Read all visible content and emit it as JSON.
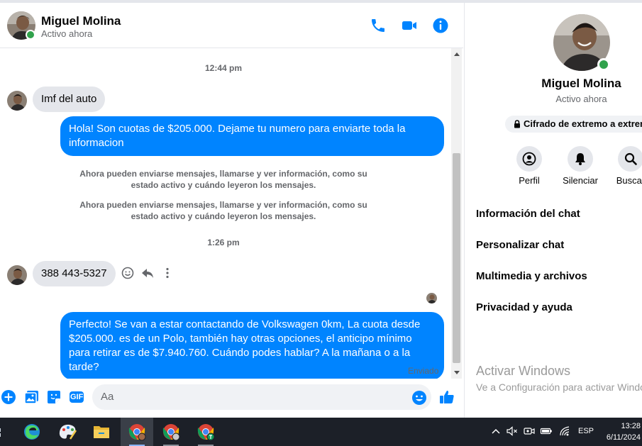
{
  "contact": {
    "name": "Miguel Molina",
    "status": "Activo ahora"
  },
  "header": {
    "icons": [
      "phone-icon",
      "video-camera-icon",
      "info-icon"
    ]
  },
  "messages": {
    "timestamp1": "12:44 pm",
    "incoming1": "Imf del auto",
    "outgoing1": "Hola! Son cuotas de $205.000. Dejame tu numero para enviarte toda la informacion",
    "system1": "Ahora pueden enviarse mensajes, llamarse y ver información, como su estado activo y cuándo leyeron los mensajes.",
    "system2": "Ahora pueden enviarse mensajes, llamarse y ver información, como su estado activo y cuándo leyeron los mensajes.",
    "timestamp2": "1:26 pm",
    "incoming2": "388 443-5327",
    "outgoing2": "Perfecto!  Se van a estar contactando de Volkswagen 0km, La cuota desde $205.000. es de un Polo, también hay otras opciones, el anticipo mínimo para retirar es de $7.940.760. Cuándo podes hablar? A la mañana o a la tarde?",
    "sent_label": "Enviado"
  },
  "composer": {
    "placeholder": "Aa",
    "gif_label": "GIF"
  },
  "info_panel": {
    "name": "Miguel Molina",
    "status": "Activo ahora",
    "encryption": "Cifrado de extremo a extremo",
    "actions": [
      {
        "label": "Perfil",
        "icon": "profile-icon"
      },
      {
        "label": "Silenciar",
        "icon": "bell-icon"
      },
      {
        "label": "Buscar",
        "icon": "search-icon"
      }
    ],
    "menu": [
      "Información del chat",
      "Personalizar chat",
      "Multimedia y archivos",
      "Privacidad y ayuda"
    ],
    "watermark_title": "Activar Windows",
    "watermark_sub": "Ve a Configuración para activar Windows."
  },
  "taskbar": {
    "language": "ESP",
    "time": "13:28",
    "date": "6/11/2024"
  },
  "colors": {
    "accent": "#0084ff",
    "online": "#31a24c",
    "incoming_bubble": "#e4e6eb",
    "taskbar": "#1c2028"
  }
}
